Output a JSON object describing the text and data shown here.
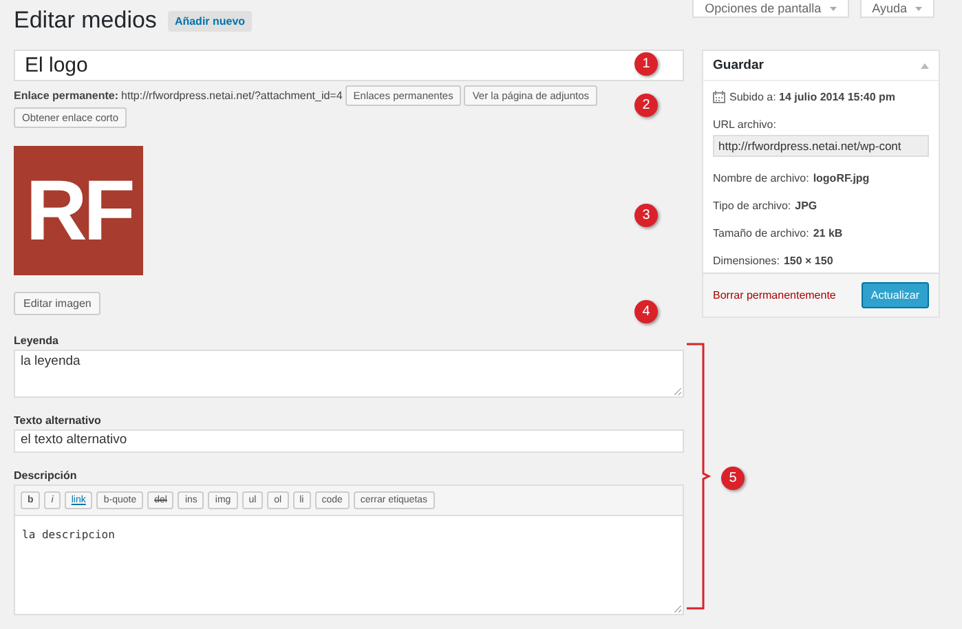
{
  "screen_tabs": [
    {
      "label": "Opciones de pantalla",
      "expanded": false
    },
    {
      "label": "Ayuda",
      "expanded": false
    }
  ],
  "header": {
    "title": "Editar medios",
    "add_new": "Añadir nuevo"
  },
  "title_field": {
    "value": "El logo"
  },
  "permalink": {
    "label": "Enlace permanente:",
    "url": "http://rfwordpress.netai.net/?attachment_id=4",
    "buttons": [
      "Enlaces permanentes",
      "Ver la página de adjuntos",
      "Obtener enlace corto"
    ]
  },
  "image": {
    "logo_text": "RF",
    "edit_button": "Editar imagen"
  },
  "fields": [
    {
      "label": "Leyenda",
      "kind": "textarea",
      "value": "la leyenda"
    },
    {
      "label": "Texto alternativo",
      "kind": "input",
      "value": "el texto alternativo"
    }
  ],
  "description": {
    "label": "Descripción",
    "toolbar": [
      {
        "label": "b",
        "kind": "bold"
      },
      {
        "label": "i",
        "kind": "italic"
      },
      {
        "label": "link",
        "kind": "link"
      },
      {
        "label": "b-quote",
        "kind": "plain"
      },
      {
        "label": "del",
        "kind": "strike"
      },
      {
        "label": "ins",
        "kind": "plain"
      },
      {
        "label": "img",
        "kind": "plain"
      },
      {
        "label": "ul",
        "kind": "plain"
      },
      {
        "label": "ol",
        "kind": "plain"
      },
      {
        "label": "li",
        "kind": "plain"
      },
      {
        "label": "code",
        "kind": "plain"
      },
      {
        "label": "cerrar etiquetas",
        "kind": "plain"
      }
    ],
    "value": "la descripcion"
  },
  "save_box": {
    "title": "Guardar",
    "expanded": true,
    "uploaded_label": "Subido a:",
    "uploaded_value": "14 julio 2014 15:40 pm",
    "url_label": "URL archivo:",
    "url_value": "http://rfwordpress.netai.net/wp-cont",
    "details": [
      {
        "label": "Nombre de archivo:",
        "value": "logoRF.jpg"
      },
      {
        "label": "Tipo de archivo:",
        "value": "JPG"
      },
      {
        "label": "Tamaño de archivo:",
        "value": "21 kB"
      },
      {
        "label": "Dimensiones:",
        "value": "150 × 150"
      }
    ],
    "delete_link": "Borrar permanentemente",
    "update_button": "Actualizar"
  },
  "annotations": [
    "1",
    "2",
    "3",
    "4",
    "5"
  ]
}
